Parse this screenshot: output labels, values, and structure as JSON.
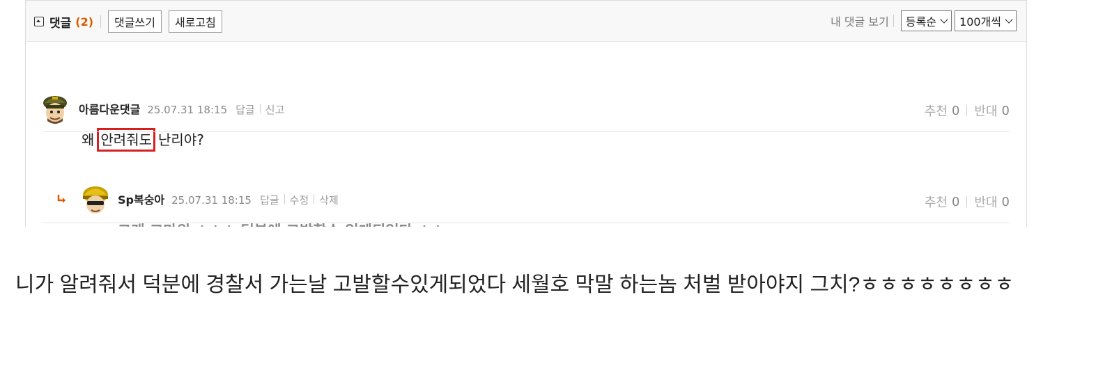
{
  "comments_header": {
    "title": "댓글",
    "count": "(2)",
    "write_button": "댓글쓰기",
    "refresh_button": "새로고침",
    "my_comments_link": "내 댓글 보기",
    "sort_select": "등록순",
    "per_page_select": "100개씩"
  },
  "comments": [
    {
      "nickname": "아름다운댓글",
      "datetime": "25.07.31 18:15",
      "actions": [
        "답글",
        "신고"
      ],
      "recommend_label": "추천",
      "recommend_count": "0",
      "oppose_label": "반대",
      "oppose_count": "0",
      "text_before": "왜",
      "text_highlight": "안려줘도",
      "text_after": "난리야?"
    }
  ],
  "reply": {
    "nickname": "Sp복숭아",
    "datetime": "25.07.31 18:15",
    "actions": [
      "답글",
      "수정",
      "삭제"
    ],
    "recommend_label": "추천",
    "recommend_count": "0",
    "oppose_label": "반대",
    "oppose_count": "0",
    "text": "그래 고마워 ㅎㅎㅎ 덕분에 고발할수 있게되었다 ㅎㅎ"
  },
  "post_body": "니가 알려줘서 덕분에 경찰서 가는날 고발할수있게되었다 세월호 막말 하는놈 처벌 받아야지 그치?ㅎㅎㅎㅎㅎㅎㅎㅎ",
  "colors": {
    "count": "#e05a00",
    "highlight_box": "#d62020",
    "reply_arrow": "#e05a00"
  }
}
